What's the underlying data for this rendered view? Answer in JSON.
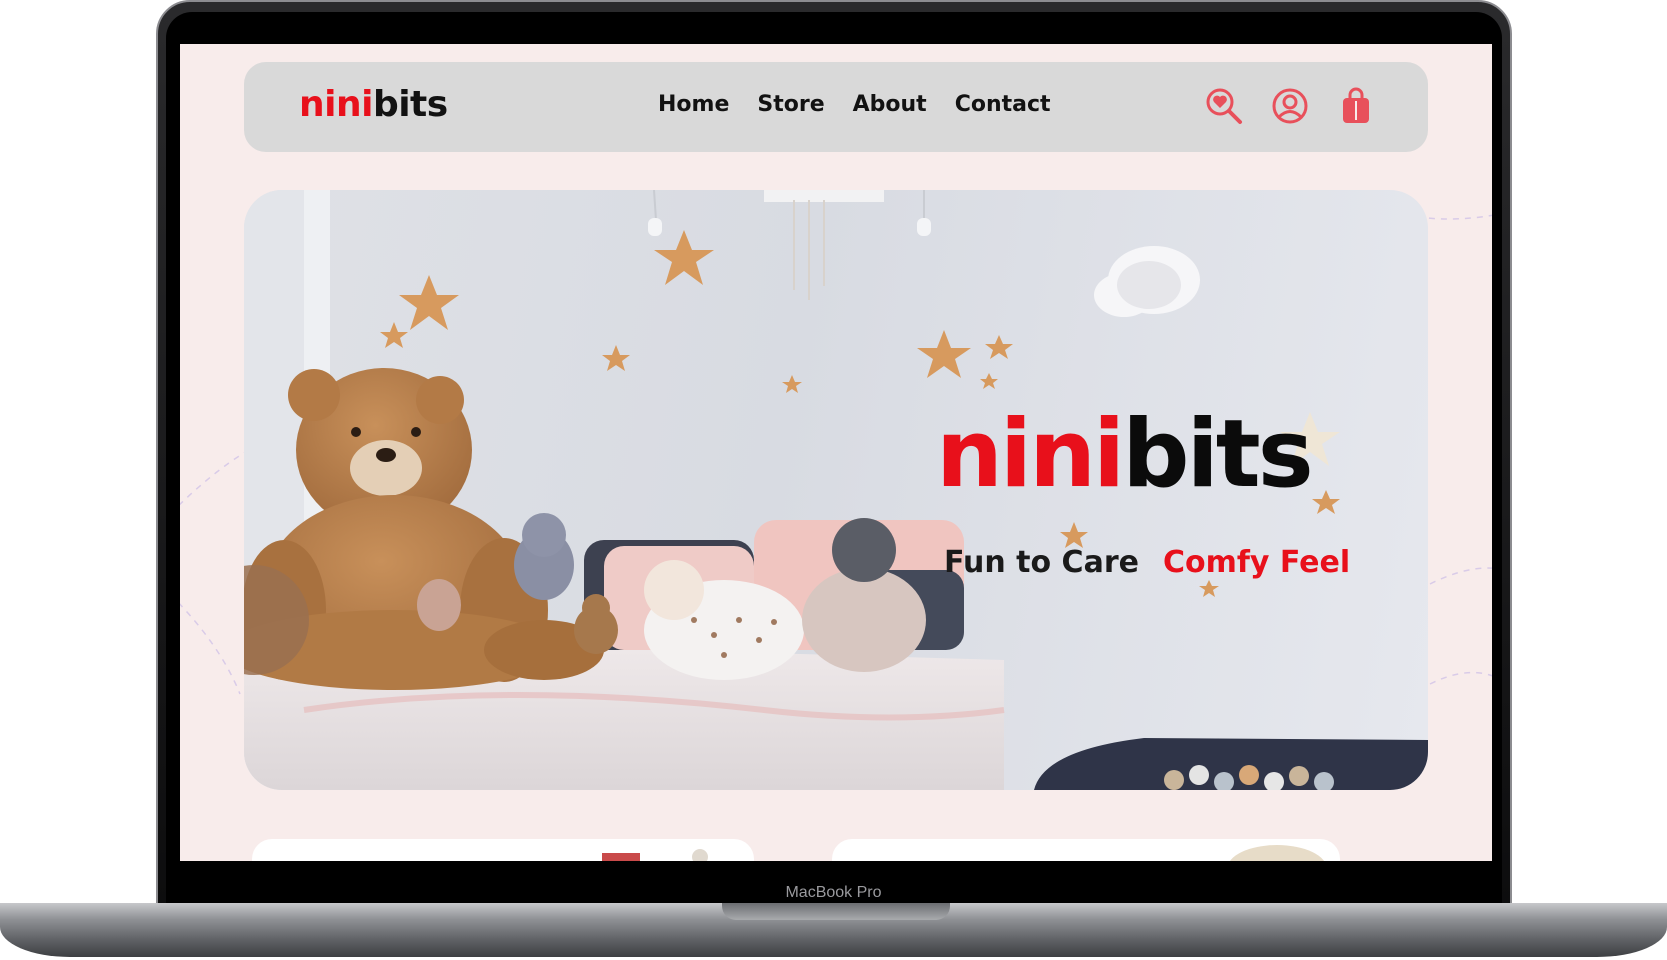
{
  "brand": {
    "part1": "nini",
    "part2": "bits"
  },
  "nav": {
    "links": [
      {
        "label": "Home"
      },
      {
        "label": "Store"
      },
      {
        "label": "About"
      },
      {
        "label": "Contact"
      }
    ],
    "icons": [
      "heart-search-icon",
      "user-icon",
      "shopping-bag-icon"
    ]
  },
  "hero": {
    "title_part1": "nini",
    "title_part2": "bits",
    "tagline_1": "Fun to Care",
    "tagline_2": "Comfy Feel"
  },
  "device": {
    "label": "MacBook Pro"
  },
  "colors": {
    "accent_red": "#e8101b",
    "icon_red": "#e8505b",
    "page_bg": "#f8eceb",
    "nav_bg": "#d9d9d9",
    "text_dark": "#121212"
  }
}
